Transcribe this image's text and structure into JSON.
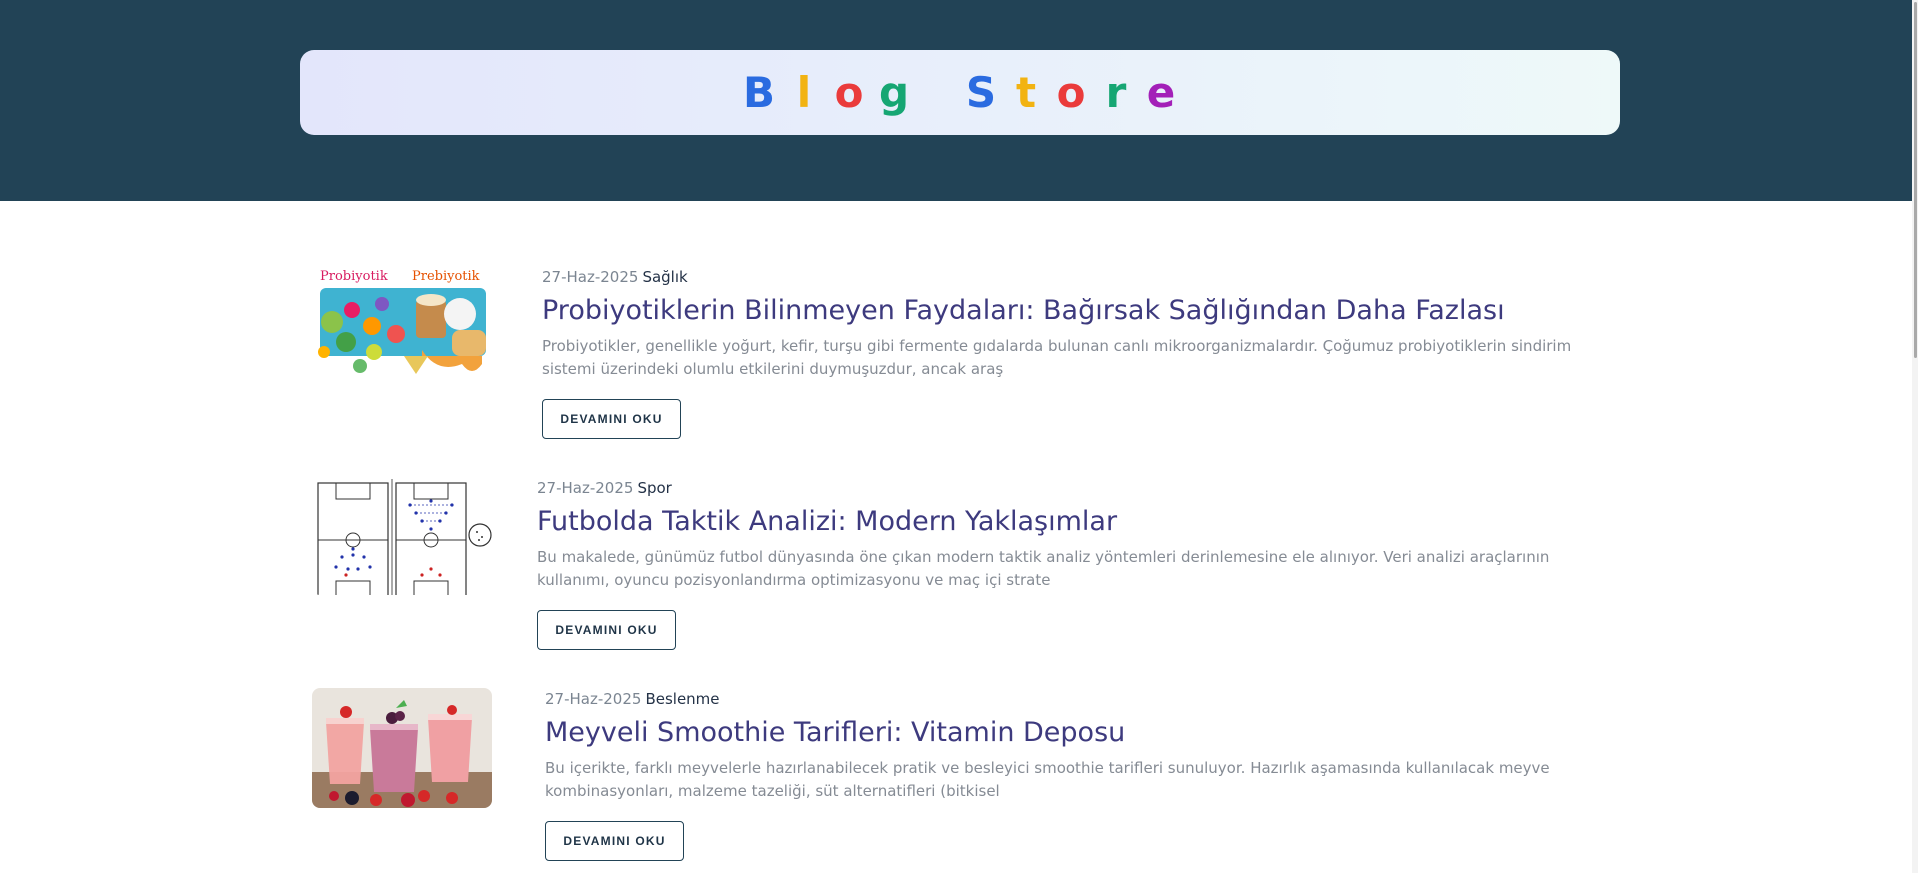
{
  "site": {
    "brand_letters": [
      "B",
      "l",
      "o",
      "g",
      "S",
      "t",
      "o",
      "r",
      "e"
    ],
    "brand_colors": [
      "#2a6be0",
      "#f2b312",
      "#ea3b3b",
      "#16a673",
      "#2a6be0",
      "#f2b312",
      "#ea3b3b",
      "#16a673",
      "#a320b8"
    ],
    "header_color": "#224356"
  },
  "posts": [
    {
      "date": "27-Haz-2025",
      "category": "Sağlık",
      "title": "Probiyotiklerin Bilinmeyen Faydaları: Bağırsak Sağlığından Daha Fazlası",
      "excerpt": "Probiyotikler, genellikle yoğurt, kefir, turşu gibi fermente gıdalarda bulunan canlı mikroorganizmalardır. Çoğumuz probiyotiklerin sindirim sistemi üzerindeki olumlu etkilerini duymuşuzdur, ancak araş",
      "button": "DEVAMINI OKU",
      "image_text_1": "Probiyotik",
      "image_text_2": "Prebiyotik"
    },
    {
      "date": "27-Haz-2025",
      "category": "Spor",
      "title": "Futbolda Taktik Analizi: Modern Yaklaşımlar",
      "excerpt": "Bu makalede, günümüz futbol dünyasında öne çıkan modern taktik analiz yöntemleri derinlemesine ele alınıyor. Veri analizi araçlarının kullanımı, oyuncu pozisyonlandırma optimizasyonu ve maç içi strate",
      "button": "DEVAMINI OKU"
    },
    {
      "date": "27-Haz-2025",
      "category": "Beslenme",
      "title": "Meyveli Smoothie Tarifleri: Vitamin Deposu",
      "excerpt": "Bu içerikte, farklı meyvelerle hazırlanabilecek pratik ve besleyici smoothie tarifleri sunuluyor. Hazırlık aşamasında kullanılacak meyve kombinasyonları, malzeme tazeliği, süt alternatifleri (bitkisel",
      "button": "DEVAMINI OKU"
    }
  ]
}
